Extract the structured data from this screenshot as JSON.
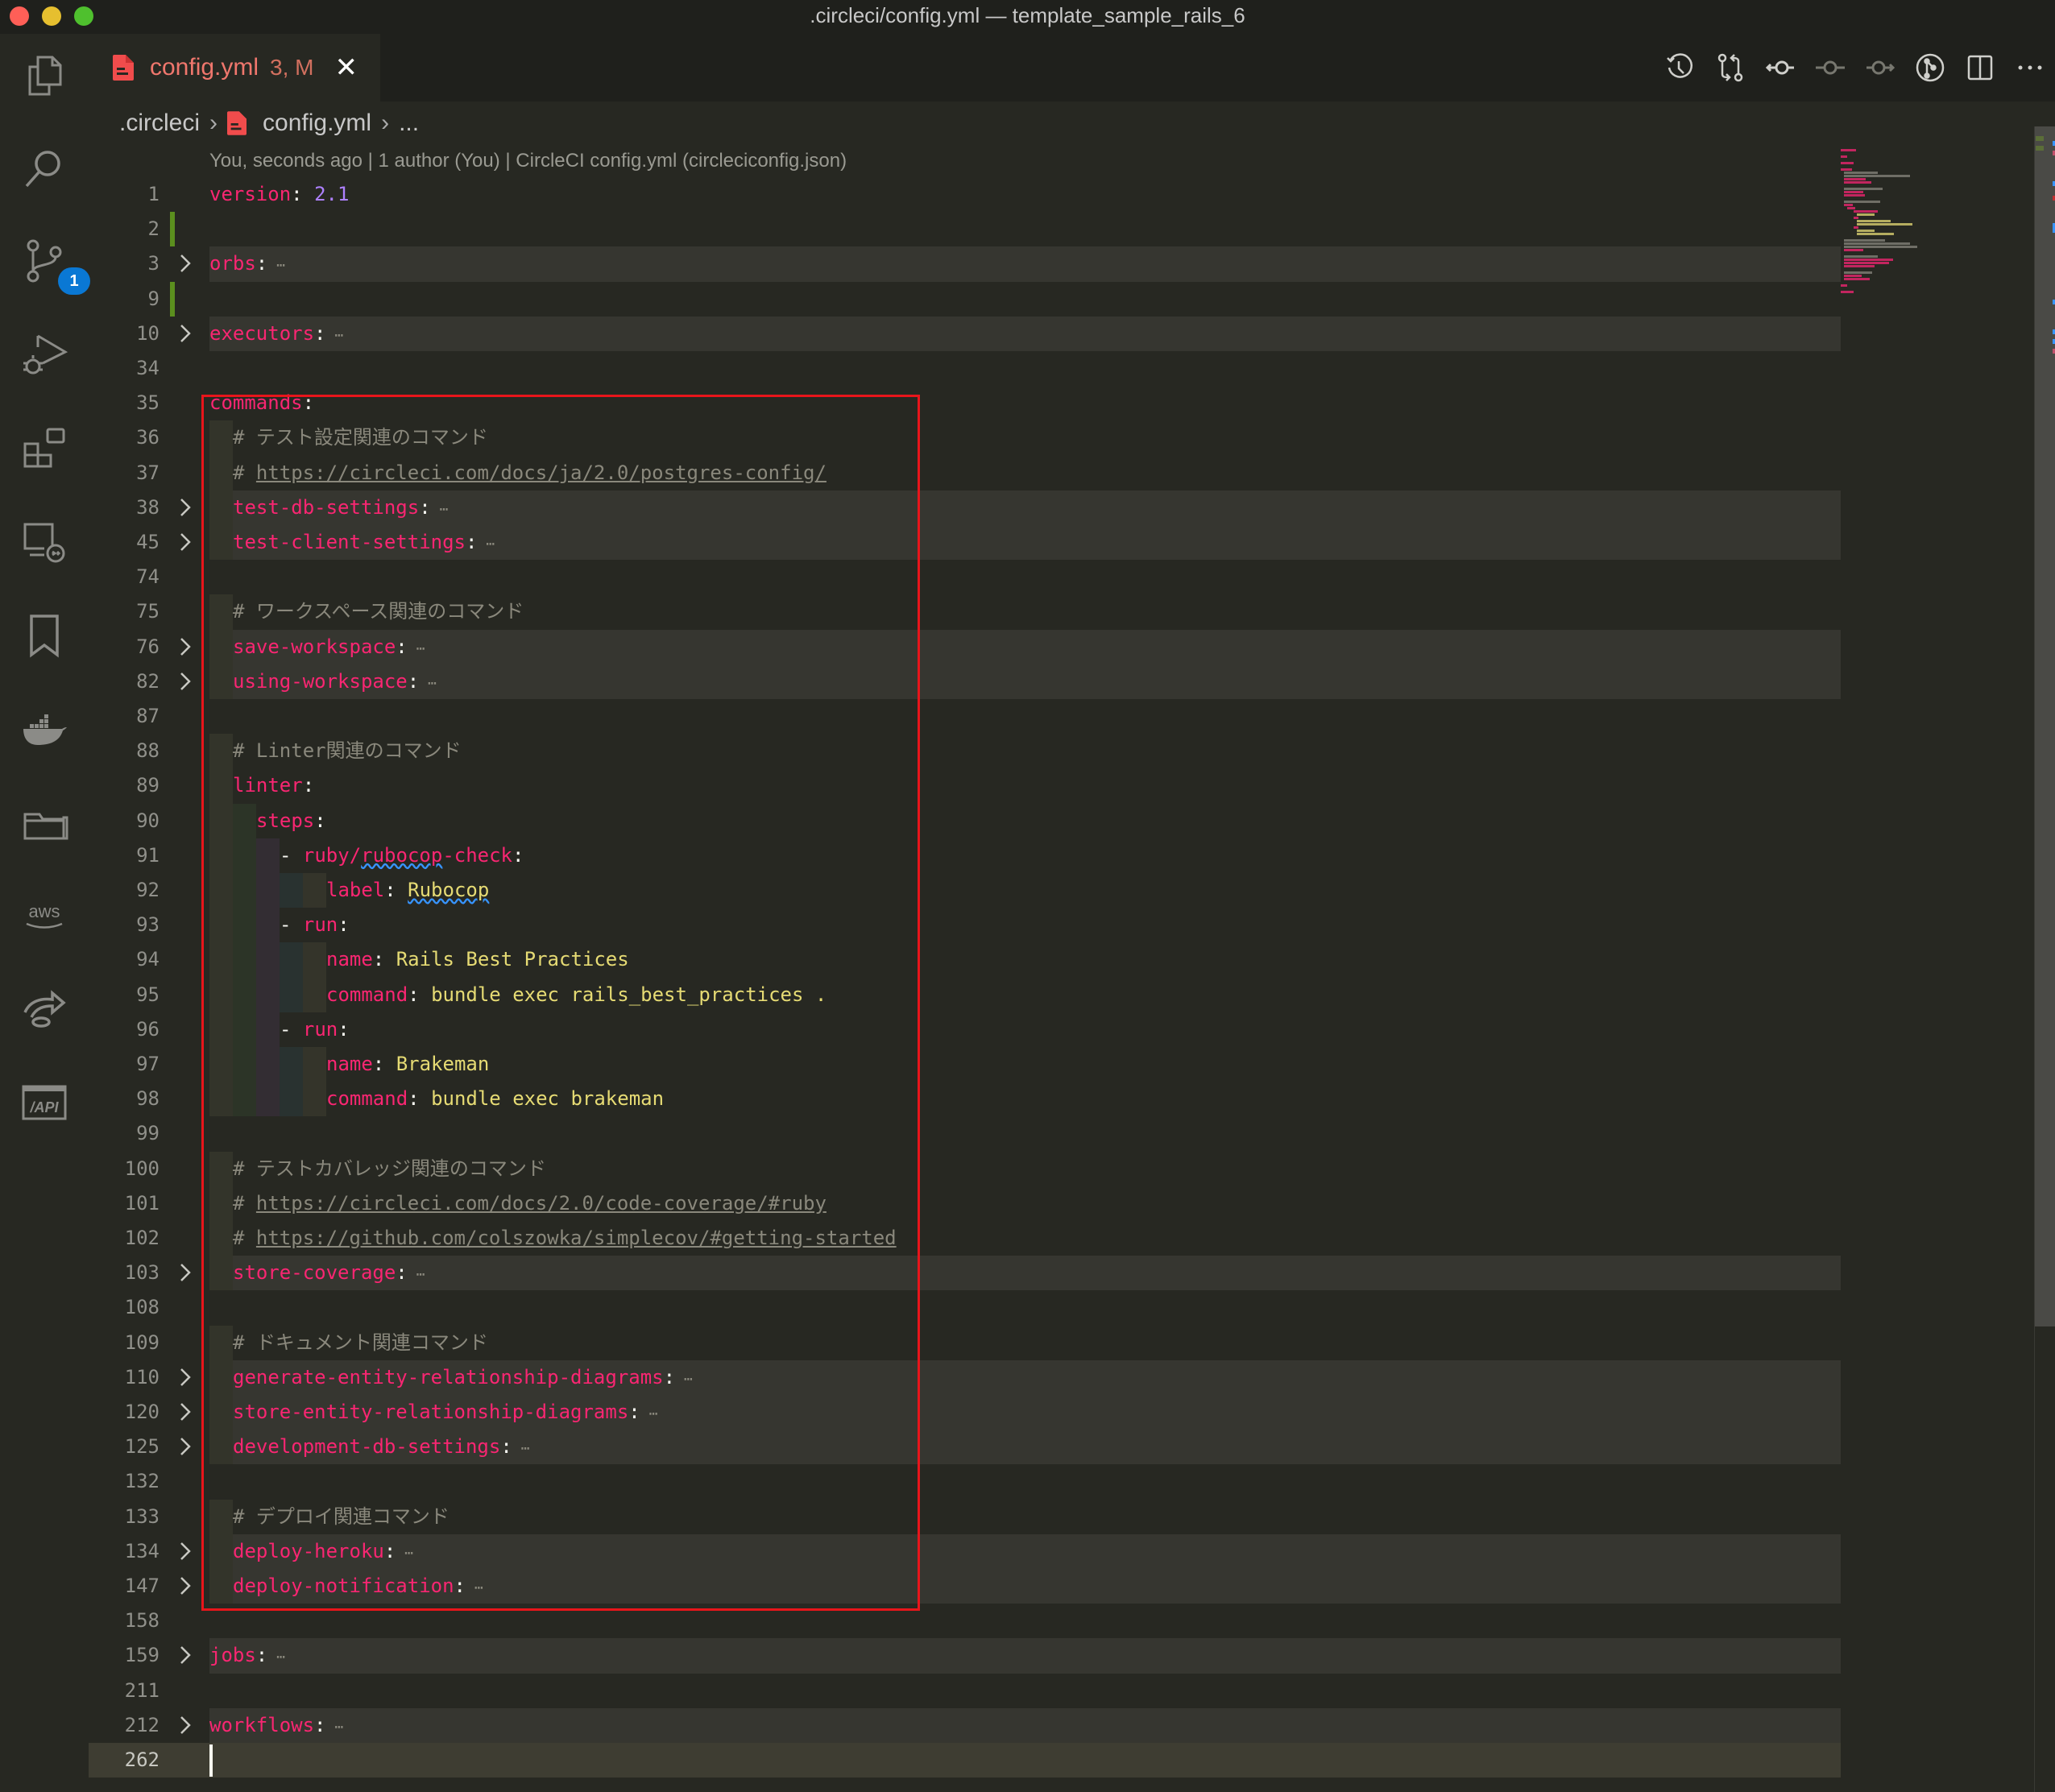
{
  "window": {
    "title": ".circleci/config.yml — template_sample_rails_6"
  },
  "activity_bar": {
    "items": [
      {
        "name": "explorer",
        "icon": "files-icon"
      },
      {
        "name": "search",
        "icon": "search-icon"
      },
      {
        "name": "source-control",
        "icon": "source-control-icon",
        "badge": "1"
      },
      {
        "name": "run-debug",
        "icon": "run-debug-icon"
      },
      {
        "name": "extensions",
        "icon": "extensions-icon"
      },
      {
        "name": "remote-explorer",
        "icon": "remote-explorer-icon"
      },
      {
        "name": "bookmarks",
        "icon": "bookmark-icon"
      },
      {
        "name": "docker",
        "icon": "docker-icon"
      },
      {
        "name": "project-manager",
        "icon": "folders-icon"
      },
      {
        "name": "aws",
        "icon": "aws-icon",
        "text": "aws"
      },
      {
        "name": "live-share",
        "icon": "live-share-icon"
      },
      {
        "name": "api",
        "icon": "api-icon",
        "text": "/API"
      }
    ]
  },
  "tab": {
    "label": "config.yml",
    "status": "3, M",
    "close": "✕"
  },
  "editor_actions": [
    "timeline-icon",
    "compare-changes-icon",
    "previous-change-icon",
    "commit-icon",
    "next-change-icon",
    "gitlens-icon",
    "split-editor-icon",
    "more-actions-icon"
  ],
  "breadcrumb": {
    "folder": ".circleci",
    "file": "config.yml",
    "more": "...",
    "sep": "›"
  },
  "codelens": "You, seconds ago | 1 author (You) | CircleCI config.yml (circleciconfig.json)",
  "lines": [
    {
      "n": "1",
      "indent": 0,
      "key": "version",
      "value": "2.1",
      "vtype": "number"
    },
    {
      "n": "2",
      "indent": 0,
      "git": "added"
    },
    {
      "n": "3",
      "indent": 0,
      "key": "orbs",
      "folded": true
    },
    {
      "n": "9",
      "indent": 0,
      "git": "added"
    },
    {
      "n": "10",
      "indent": 0,
      "key": "executors",
      "folded": true
    },
    {
      "n": "34",
      "indent": 0
    },
    {
      "n": "35",
      "indent": 0,
      "key": "commands"
    },
    {
      "n": "36",
      "indent": 1,
      "comment": "テスト設定関連のコマンド"
    },
    {
      "n": "37",
      "indent": 1,
      "comment_url": "https://circleci.com/docs/ja/2.0/postgres-config/"
    },
    {
      "n": "38",
      "indent": 1,
      "key": "test-db-settings",
      "folded": true
    },
    {
      "n": "45",
      "indent": 1,
      "key": "test-client-settings",
      "folded": true
    },
    {
      "n": "74",
      "indent": 0
    },
    {
      "n": "75",
      "indent": 1,
      "comment": "ワークスペース関連のコマンド"
    },
    {
      "n": "76",
      "indent": 1,
      "key": "save-workspace",
      "folded": true
    },
    {
      "n": "82",
      "indent": 1,
      "key": "using-workspace",
      "folded": true
    },
    {
      "n": "87",
      "indent": 0
    },
    {
      "n": "88",
      "indent": 1,
      "comment": "Linter関連のコマンド"
    },
    {
      "n": "89",
      "indent": 1,
      "key": "linter"
    },
    {
      "n": "90",
      "indent": 2,
      "key": "steps"
    },
    {
      "n": "91",
      "indent": 3,
      "dash": true,
      "key": "ruby/rubocop-check",
      "squiggle": "rubocop"
    },
    {
      "n": "92",
      "indent": 5,
      "key": "label",
      "value": "Rubocop",
      "vtype": "string",
      "squiggle_value": true
    },
    {
      "n": "93",
      "indent": 3,
      "dash": true,
      "key": "run"
    },
    {
      "n": "94",
      "indent": 5,
      "key": "name",
      "value": "Rails Best Practices",
      "vtype": "string"
    },
    {
      "n": "95",
      "indent": 5,
      "key": "command",
      "value": "bundle exec rails_best_practices .",
      "vtype": "string"
    },
    {
      "n": "96",
      "indent": 3,
      "dash": true,
      "key": "run"
    },
    {
      "n": "97",
      "indent": 5,
      "key": "name",
      "value": "Brakeman",
      "vtype": "string"
    },
    {
      "n": "98",
      "indent": 5,
      "key": "command",
      "value": "bundle exec brakeman",
      "vtype": "string"
    },
    {
      "n": "99",
      "indent": 0
    },
    {
      "n": "100",
      "indent": 1,
      "comment": "テストカバレッジ関連のコマンド"
    },
    {
      "n": "101",
      "indent": 1,
      "comment_url": "https://circleci.com/docs/2.0/code-coverage/#ruby"
    },
    {
      "n": "102",
      "indent": 1,
      "comment_url": "https://github.com/colszowka/simplecov/#getting-started"
    },
    {
      "n": "103",
      "indent": 1,
      "key": "store-coverage",
      "folded": true
    },
    {
      "n": "108",
      "indent": 0
    },
    {
      "n": "109",
      "indent": 1,
      "comment": "ドキュメント関連コマンド"
    },
    {
      "n": "110",
      "indent": 1,
      "key": "generate-entity-relationship-diagrams",
      "folded": true
    },
    {
      "n": "120",
      "indent": 1,
      "key": "store-entity-relationship-diagrams",
      "folded": true
    },
    {
      "n": "125",
      "indent": 1,
      "key": "development-db-settings",
      "folded": true
    },
    {
      "n": "132",
      "indent": 0
    },
    {
      "n": "133",
      "indent": 1,
      "comment": "デプロイ関連コマンド"
    },
    {
      "n": "134",
      "indent": 1,
      "key": "deploy-heroku",
      "folded": true
    },
    {
      "n": "147",
      "indent": 1,
      "key": "deploy-notification",
      "folded": true
    },
    {
      "n": "158",
      "indent": 0
    },
    {
      "n": "159",
      "indent": 0,
      "key": "jobs",
      "folded": true
    },
    {
      "n": "211",
      "indent": 0
    },
    {
      "n": "212",
      "indent": 0,
      "key": "workflows",
      "folded": true
    },
    {
      "n": "262",
      "indent": 0,
      "current": true
    }
  ],
  "symbols": {
    "colon": ":",
    "ellipsis": "⋯",
    "hash": "# ",
    "dash": "- "
  },
  "colors": {
    "key": "#f92672",
    "string": "#e6db74",
    "number": "#ae81ff",
    "comment": "#8a887c",
    "highlight_box": "#e8151b",
    "git_added": "#5b8f1e",
    "badge": "#0a78d4"
  }
}
